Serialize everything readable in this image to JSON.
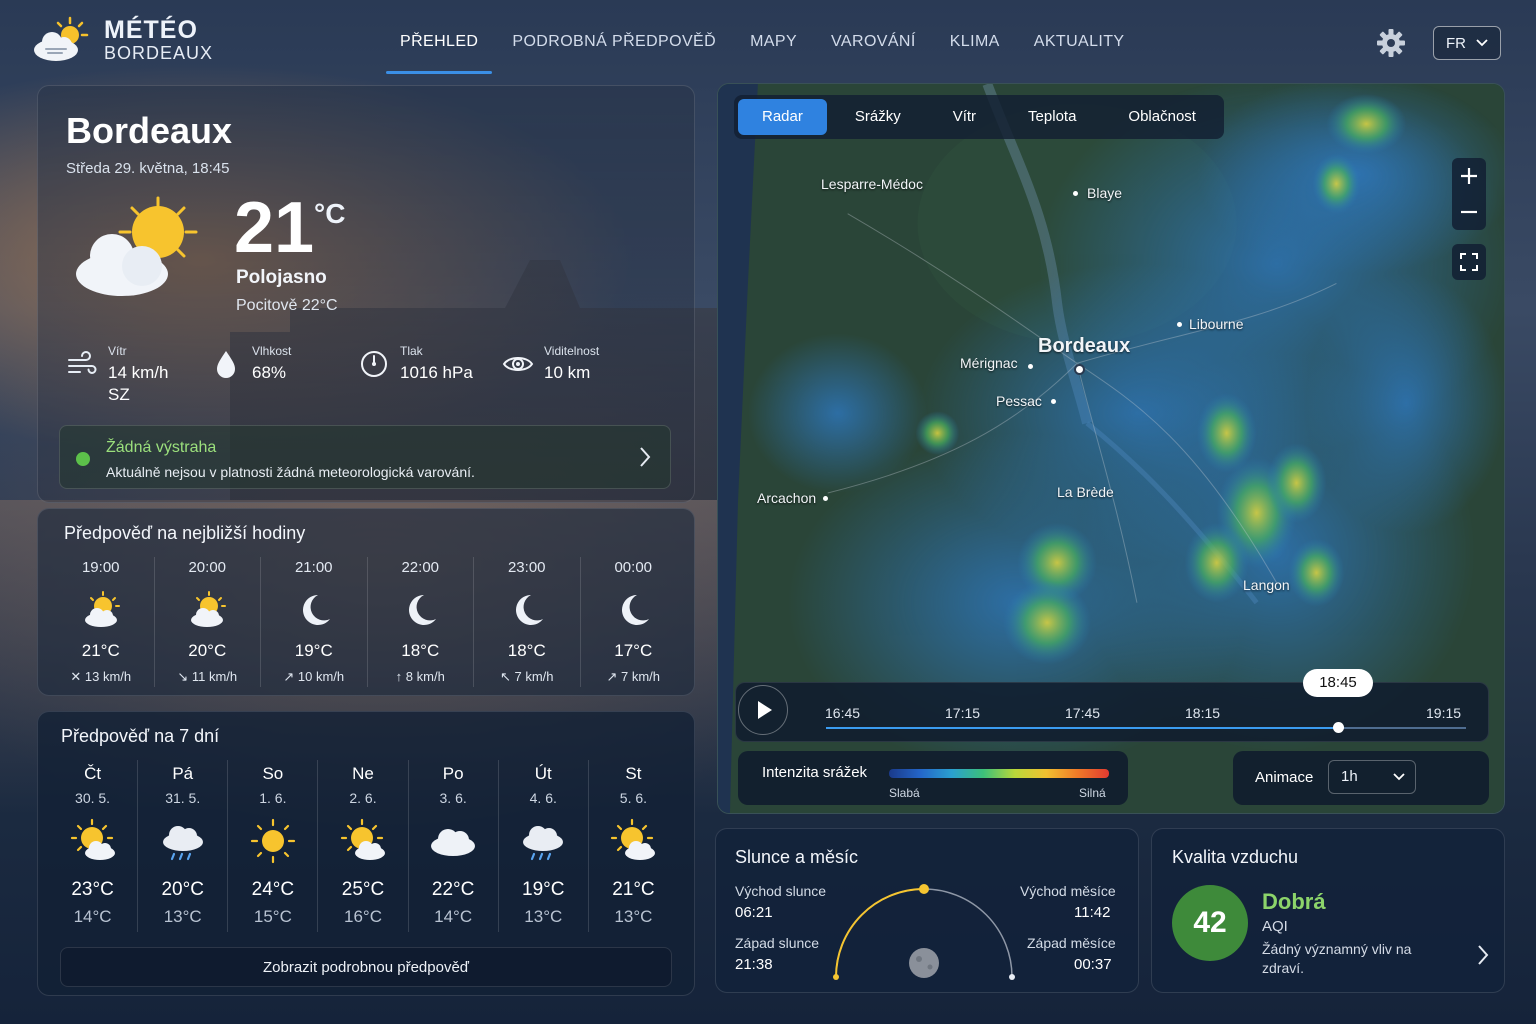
{
  "header": {
    "logo_title": "MÉTÉO",
    "logo_sub": "BORDEAUX",
    "nav": [
      {
        "label": "PŘEHLED",
        "active": true
      },
      {
        "label": "PODROBNÁ PŘEDPOVĚĎ",
        "active": false
      },
      {
        "label": "MAPY",
        "active": false
      },
      {
        "label": "VAROVÁNÍ",
        "active": false
      },
      {
        "label": "KLIMA",
        "active": false
      },
      {
        "label": "AKTUALITY",
        "active": false
      }
    ],
    "language": "FR"
  },
  "current": {
    "city": "Bordeaux",
    "datetime": "Středa 29. května, 18:45",
    "temperature": "21",
    "unit": "°C",
    "condition": "Polojasno",
    "feels_like": "Pocitově 22°C",
    "stats": {
      "wind": {
        "label": "Vítr",
        "value": "14 km/h",
        "dir": "SZ",
        "icon": "wind-icon"
      },
      "humidity": {
        "label": "Vlhkost",
        "value": "68%",
        "icon": "droplet-icon"
      },
      "pressure": {
        "label": "Tlak",
        "value": "1016 hPa",
        "icon": "gauge-icon"
      },
      "visibility": {
        "label": "Viditelnost",
        "value": "10 km",
        "icon": "eye-icon"
      }
    },
    "alert": {
      "title": "Žádná výstraha",
      "text": "Aktuálně nejsou v platnosti žádná meteorologická varování.",
      "color": "#5cc04a"
    }
  },
  "hourly": {
    "title": "Předpověď na nejbližší hodiny",
    "items": [
      {
        "time": "19:00",
        "icon": "partly-sunny-icon",
        "temp": "21°C",
        "wind": "13 km/h",
        "arrow": "✕"
      },
      {
        "time": "20:00",
        "icon": "partly-sunny-icon",
        "temp": "20°C",
        "wind": "11 km/h",
        "arrow": "↘"
      },
      {
        "time": "21:00",
        "icon": "moon-icon",
        "temp": "19°C",
        "wind": "10 km/h",
        "arrow": "↗"
      },
      {
        "time": "22:00",
        "icon": "moon-icon",
        "temp": "18°C",
        "wind": "8 km/h",
        "arrow": "↑"
      },
      {
        "time": "23:00",
        "icon": "moon-icon",
        "temp": "18°C",
        "wind": "7 km/h",
        "arrow": "↖"
      },
      {
        "time": "00:00",
        "icon": "moon-icon",
        "temp": "17°C",
        "wind": "7 km/h",
        "arrow": "↗"
      }
    ]
  },
  "daily": {
    "title": "Předpověď na 7 dní",
    "items": [
      {
        "day": "Čt",
        "date": "30. 5.",
        "icon": "partly-sunny-icon",
        "hi": "23°C",
        "lo": "14°C"
      },
      {
        "day": "Pá",
        "date": "31. 5.",
        "icon": "rain-icon",
        "hi": "20°C",
        "lo": "13°C"
      },
      {
        "day": "So",
        "date": "1. 6.",
        "icon": "sun-icon",
        "hi": "24°C",
        "lo": "15°C"
      },
      {
        "day": "Ne",
        "date": "2. 6.",
        "icon": "partly-sunny-icon",
        "hi": "25°C",
        "lo": "16°C"
      },
      {
        "day": "Po",
        "date": "3. 6.",
        "icon": "cloud-icon",
        "hi": "22°C",
        "lo": "14°C"
      },
      {
        "day": "Út",
        "date": "4. 6.",
        "icon": "rain-icon",
        "hi": "19°C",
        "lo": "13°C"
      },
      {
        "day": "St",
        "date": "5. 6.",
        "icon": "partly-sunny-icon",
        "hi": "21°C",
        "lo": "13°C"
      }
    ],
    "more_label": "Zobrazit podrobnou předpověď"
  },
  "map": {
    "tabs": [
      {
        "label": "Radar",
        "active": true
      },
      {
        "label": "Srážky",
        "active": false
      },
      {
        "label": "Vítr",
        "active": false
      },
      {
        "label": "Teplota",
        "active": false
      },
      {
        "label": "Oblačnost",
        "active": false
      }
    ],
    "places": {
      "lesparre": "Lesparre-Médoc",
      "blaye": "Blaye",
      "libourne": "Libourne",
      "bordeaux": "Bordeaux",
      "merignac": "Mérignac",
      "pessac": "Pessac",
      "arcachon": "Arcachon",
      "labrede": "La Brède",
      "langon": "Langon"
    },
    "timeline": {
      "ticks": [
        "16:45",
        "17:15",
        "17:45",
        "18:15",
        "19:15"
      ],
      "current": "18:45",
      "progress": 0.8
    },
    "legend": {
      "title": "Intenzita srážek",
      "low": "Slabá",
      "high": "Silná"
    },
    "animation": {
      "label": "Animace",
      "value": "1h"
    }
  },
  "sun_moon": {
    "title": "Slunce a měsíc",
    "sunrise_label": "Východ slunce",
    "sunrise": "06:21",
    "sunset_label": "Západ slunce",
    "sunset": "21:38",
    "moonrise_label": "Východ měsíce",
    "moonrise": "11:42",
    "moonset_label": "Západ měsíce",
    "moonset": "00:37"
  },
  "air": {
    "title": "Kvalita vzduchu",
    "aqi": "42",
    "status": "Dobrá",
    "unit": "AQI",
    "note": "Žádný významný vliv na zdraví."
  }
}
